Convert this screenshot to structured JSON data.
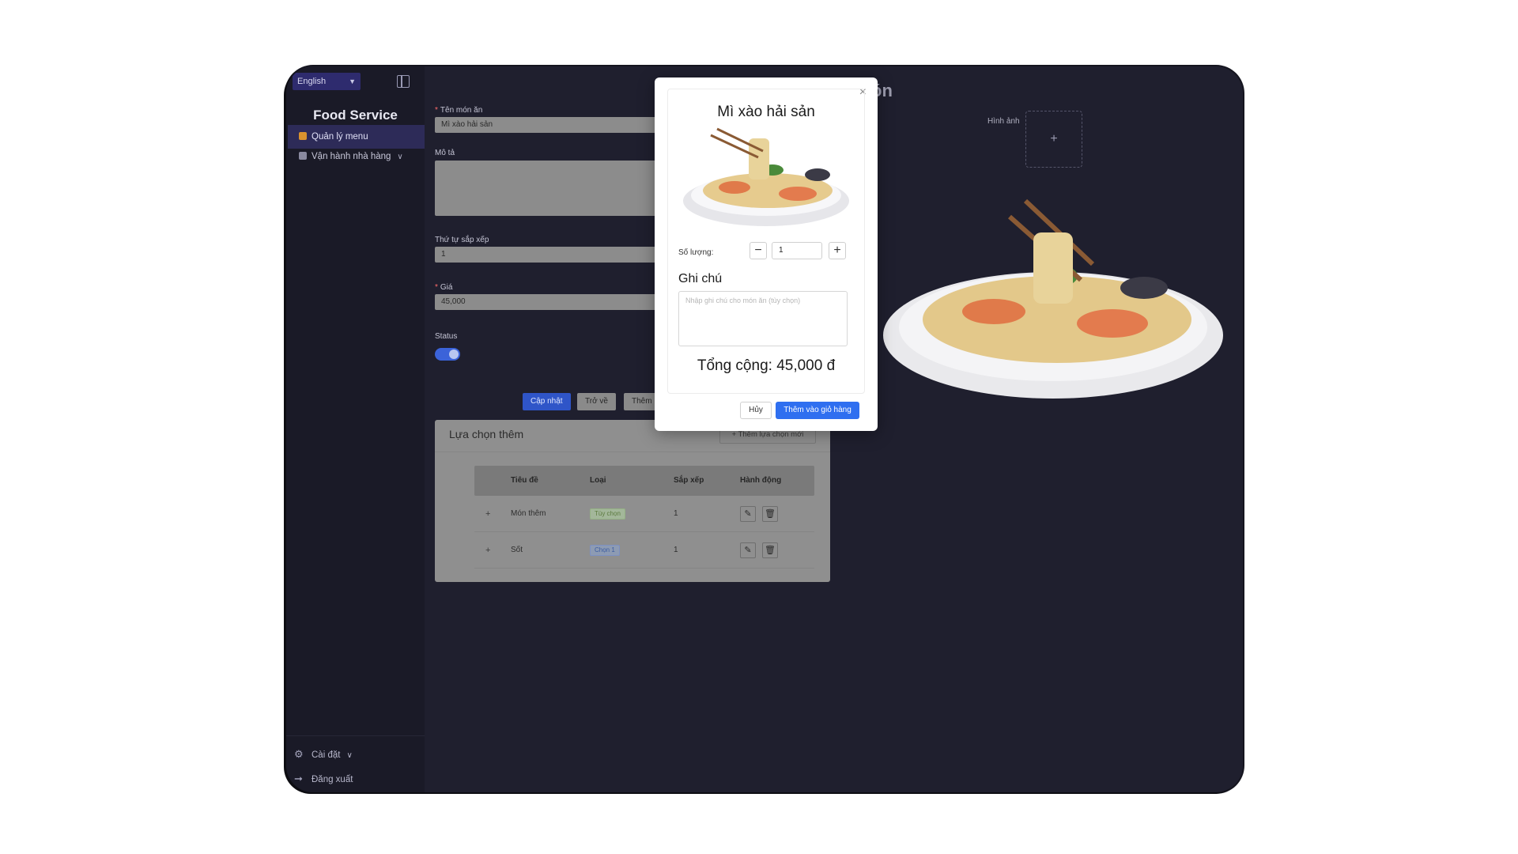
{
  "sidebar": {
    "language": "English",
    "brand": "Food Service",
    "items": [
      {
        "label": "Quản lý menu"
      },
      {
        "label": "Vận hành nhà hàng"
      }
    ],
    "footer": {
      "settings": "Cài đặt",
      "logout": "Đăng xuất"
    }
  },
  "form": {
    "name_label": "Tên món ăn",
    "name_value": "Mì xào hải sản",
    "desc_label": "Mô tả",
    "order_label": "Thứ tự sắp xếp",
    "order_value": "1",
    "price_label": "Giá",
    "price_value": "45,000",
    "status_label": "Status",
    "status_on": true,
    "buttons": {
      "update": "Cập nhật",
      "back": "Trở về",
      "add_partial": "Thêm r"
    },
    "heading_partial": "ón",
    "image_label": "Hình ảnh",
    "image_upload": "+"
  },
  "options": {
    "title": "Lựa chọn thêm",
    "add_button": "Thêm lựa chọn mới",
    "columns": [
      "Tiêu đề",
      "Loại",
      "Sắp xếp",
      "Hành động"
    ],
    "rows": [
      {
        "expand": "+",
        "title": "Món thêm",
        "type": "Tùy chọn",
        "order": "1"
      },
      {
        "expand": "+",
        "title": "Sốt",
        "type": "Chọn 1",
        "order": "1"
      }
    ]
  },
  "modal": {
    "title": "Mì xào hải sản",
    "qty_label": "Số lượng:",
    "qty_value": "1",
    "minus": "−",
    "plus": "+",
    "note_title": "Ghi chú",
    "note_placeholder": "Nhập ghi chú cho món ăn (tùy chọn)",
    "total": "Tổng cộng: 45,000 đ",
    "cancel": "Hủy",
    "add_to_cart": "Thêm vào giỏ hàng",
    "close": "×"
  },
  "colors": {
    "accent": "#2f6ff0",
    "sidebar_active": "#2d2b58",
    "background": "#1f1f2e"
  }
}
